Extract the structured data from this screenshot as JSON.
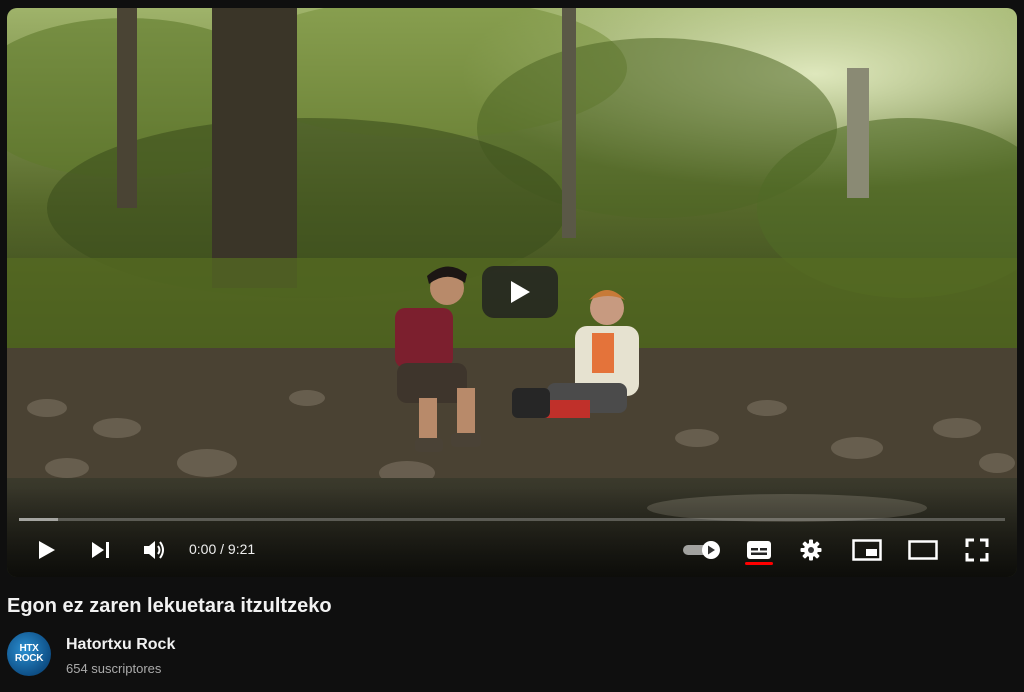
{
  "video": {
    "current_time": "0:00",
    "duration": "9:21",
    "time_display": "0:00 / 9:21",
    "progress_fraction": 0.0,
    "loaded_fraction": 0.04,
    "title": "Egon ez zaren lekuetara itzultzeko"
  },
  "controls": {
    "icons": [
      "play-icon",
      "next-icon",
      "volume-icon",
      "autoplay-toggle-icon",
      "subtitles-icon",
      "settings-icon",
      "miniplayer-icon",
      "theater-mode-icon",
      "fullscreen-icon"
    ],
    "subtitles_active_color": "#ff0000"
  },
  "channel": {
    "name": "Hatortxu Rock",
    "subscribers": "654 suscriptores",
    "avatar_line1": "HTX",
    "avatar_line2": "ROCK"
  },
  "colors": {
    "background": "#0f0f0f",
    "text_primary": "#f1f1f1",
    "text_secondary": "#aaaaaa",
    "accent_red": "#ff0000"
  }
}
